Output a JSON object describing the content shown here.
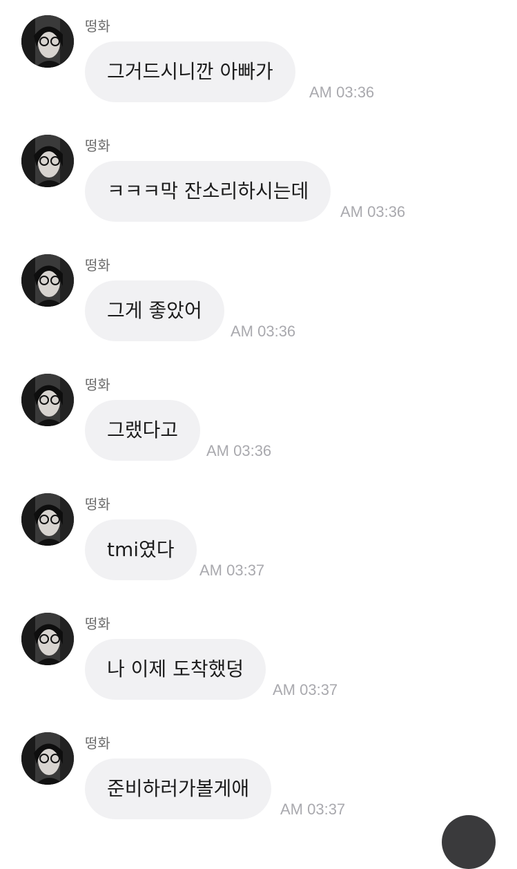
{
  "messages": [
    {
      "sender": "떵화",
      "text": "그거드시니깐 아빠가",
      "time": "AM 03:36"
    },
    {
      "sender": "떵화",
      "text": "ㅋㅋㅋ막 잔소리하시는데",
      "time": "AM 03:36"
    },
    {
      "sender": "떵화",
      "text": "그게 좋았어",
      "time": "AM 03:36"
    },
    {
      "sender": "떵화",
      "text": "그랬다고",
      "time": "AM 03:36"
    },
    {
      "sender": "떵화",
      "text": "tmi였다",
      "time": "AM 03:37"
    },
    {
      "sender": "떵화",
      "text": "나 이제 도착했덩",
      "time": "AM 03:37"
    },
    {
      "sender": "떵화",
      "text": "준비하러가볼게애",
      "time": "AM 03:37"
    }
  ],
  "colors": {
    "bubble": "#f1f1f3",
    "timestamp": "#a9a9ae",
    "sender": "#6b6b6b",
    "scroll_button": "#3a3a3c"
  },
  "icons": {
    "avatar": "profile-photo",
    "scroll_button": "scroll-down-button"
  }
}
